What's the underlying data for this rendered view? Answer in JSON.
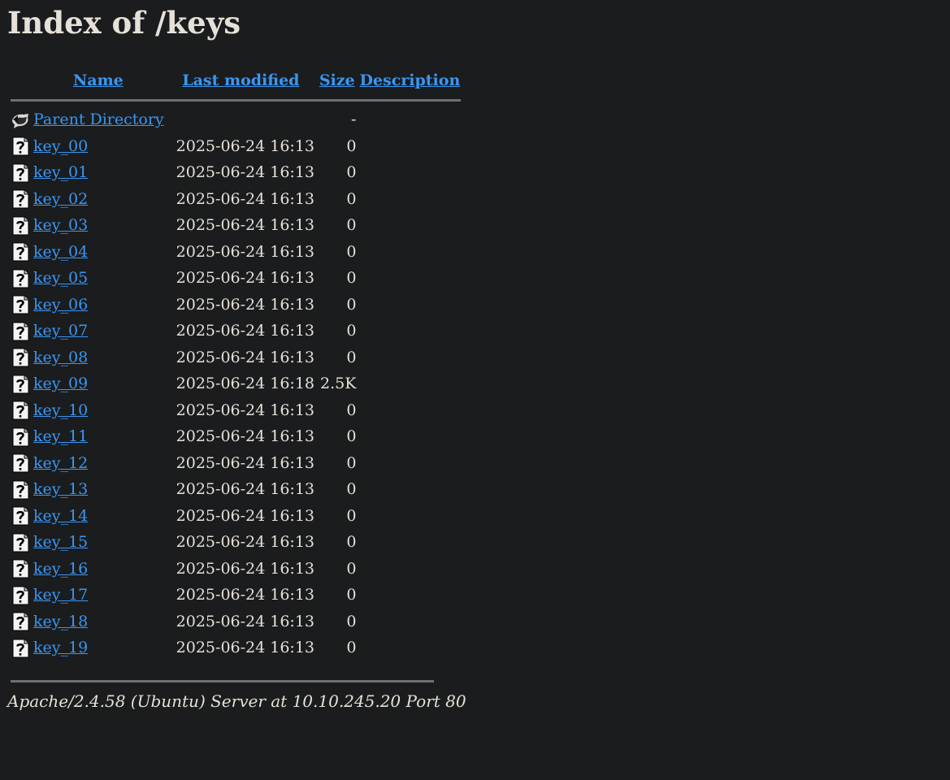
{
  "title": "Index of /keys",
  "columns": {
    "name": "Name",
    "last_modified": "Last modified",
    "size": "Size",
    "description": "Description"
  },
  "parent": {
    "label": "Parent Directory",
    "size": "-",
    "icon": "back-folder-icon"
  },
  "files": [
    {
      "name": "key_00",
      "modified": "2025-06-24 16:13",
      "size": "0",
      "icon": "unknown-file-icon"
    },
    {
      "name": "key_01",
      "modified": "2025-06-24 16:13",
      "size": "0",
      "icon": "unknown-file-icon"
    },
    {
      "name": "key_02",
      "modified": "2025-06-24 16:13",
      "size": "0",
      "icon": "unknown-file-icon"
    },
    {
      "name": "key_03",
      "modified": "2025-06-24 16:13",
      "size": "0",
      "icon": "unknown-file-icon"
    },
    {
      "name": "key_04",
      "modified": "2025-06-24 16:13",
      "size": "0",
      "icon": "unknown-file-icon"
    },
    {
      "name": "key_05",
      "modified": "2025-06-24 16:13",
      "size": "0",
      "icon": "unknown-file-icon"
    },
    {
      "name": "key_06",
      "modified": "2025-06-24 16:13",
      "size": "0",
      "icon": "unknown-file-icon"
    },
    {
      "name": "key_07",
      "modified": "2025-06-24 16:13",
      "size": "0",
      "icon": "unknown-file-icon"
    },
    {
      "name": "key_08",
      "modified": "2025-06-24 16:13",
      "size": "0",
      "icon": "unknown-file-icon"
    },
    {
      "name": "key_09",
      "modified": "2025-06-24 16:18",
      "size": "2.5K",
      "icon": "unknown-file-icon"
    },
    {
      "name": "key_10",
      "modified": "2025-06-24 16:13",
      "size": "0",
      "icon": "unknown-file-icon"
    },
    {
      "name": "key_11",
      "modified": "2025-06-24 16:13",
      "size": "0",
      "icon": "unknown-file-icon"
    },
    {
      "name": "key_12",
      "modified": "2025-06-24 16:13",
      "size": "0",
      "icon": "unknown-file-icon"
    },
    {
      "name": "key_13",
      "modified": "2025-06-24 16:13",
      "size": "0",
      "icon": "unknown-file-icon"
    },
    {
      "name": "key_14",
      "modified": "2025-06-24 16:13",
      "size": "0",
      "icon": "unknown-file-icon"
    },
    {
      "name": "key_15",
      "modified": "2025-06-24 16:13",
      "size": "0",
      "icon": "unknown-file-icon"
    },
    {
      "name": "key_16",
      "modified": "2025-06-24 16:13",
      "size": "0",
      "icon": "unknown-file-icon"
    },
    {
      "name": "key_17",
      "modified": "2025-06-24 16:13",
      "size": "0",
      "icon": "unknown-file-icon"
    },
    {
      "name": "key_18",
      "modified": "2025-06-24 16:13",
      "size": "0",
      "icon": "unknown-file-icon"
    },
    {
      "name": "key_19",
      "modified": "2025-06-24 16:13",
      "size": "0",
      "icon": "unknown-file-icon"
    }
  ],
  "footer": "Apache/2.4.58 (Ubuntu) Server at 10.10.245.20 Port 80",
  "colors": {
    "background": "#1b1c1e",
    "text": "#e6e1d8",
    "link": "#3a97f3",
    "rule": "#6f6f6f"
  }
}
